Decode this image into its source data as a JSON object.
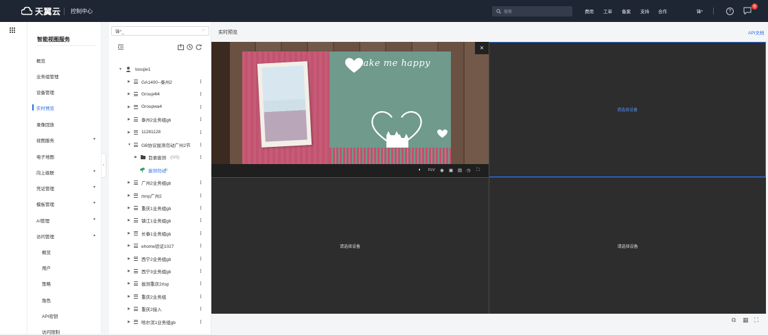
{
  "topbar": {
    "brand": "天翼云",
    "console": "控制中心",
    "search_placeholder": "搜索",
    "nav": [
      "费用",
      "工单",
      "备案",
      "支持",
      "合作"
    ],
    "user": "锋*",
    "help_icon": "?",
    "notification_count": "6"
  },
  "sidebar": {
    "title": "智能视图服务",
    "items": [
      {
        "label": "概览"
      },
      {
        "label": "业务组管理"
      },
      {
        "label": "设备管理"
      },
      {
        "label": "实时预览",
        "active": true
      },
      {
        "label": "录像回放"
      },
      {
        "label": "视图服务",
        "caret": "▾"
      },
      {
        "label": "电子地图"
      },
      {
        "label": "向上级联",
        "caret": "▾"
      },
      {
        "label": "凭证管理",
        "caret": "▾"
      },
      {
        "label": "模板管理",
        "caret": "▾"
      },
      {
        "label": "AI管理",
        "caret": "▾"
      },
      {
        "label": "访问管理",
        "caret": "▴"
      },
      {
        "label": "概览"
      },
      {
        "label": "用户"
      },
      {
        "label": "策略"
      },
      {
        "label": "角色"
      },
      {
        "label": "API密钥"
      },
      {
        "label": "访问限制"
      }
    ]
  },
  "tree": {
    "select_value": "锋*_",
    "root": "toxujie1",
    "nodes": [
      {
        "label": "GA1400--泰州2",
        "type": "group",
        "level": 1
      },
      {
        "label": "Group4l4",
        "type": "group",
        "level": 1
      },
      {
        "label": "Groupwa4",
        "type": "group",
        "level": 1
      },
      {
        "label": "泰州2业务组gb",
        "type": "group",
        "level": 1
      },
      {
        "label": "11281128",
        "type": "group",
        "level": 1
      },
      {
        "label": "GB协议拔测勿动广州2节",
        "type": "group",
        "level": 1,
        "expanded": true
      },
      {
        "label": "目录拔测",
        "suffix": "(0/0)",
        "type": "folder",
        "level": 2
      },
      {
        "label": "拔测勿动",
        "suffix": "ılı",
        "type": "camera",
        "level": 2,
        "playing": true
      },
      {
        "label": "广州2业务组gb",
        "type": "group",
        "level": 1
      },
      {
        "label": "rtmp广州2",
        "type": "group",
        "level": 1
      },
      {
        "label": "重庆1业务组gb",
        "type": "group",
        "level": 1
      },
      {
        "label": "镇江1业务组gb",
        "type": "group",
        "level": 1
      },
      {
        "label": "长春1业务组gb",
        "type": "group",
        "level": 1
      },
      {
        "label": "ehome验证1027",
        "type": "group",
        "level": 1
      },
      {
        "label": "西宁2业务组gb",
        "type": "group",
        "level": 1
      },
      {
        "label": "西宁3业务组gb",
        "type": "group",
        "level": 1
      },
      {
        "label": "拔测重庆2rtsp",
        "type": "group",
        "level": 1
      },
      {
        "label": "重庆2业务组",
        "type": "group",
        "level": 1
      },
      {
        "label": "重庆2接入",
        "type": "group",
        "level": 1
      },
      {
        "label": "哈尔滨1业务组gb",
        "type": "group",
        "level": 1
      }
    ]
  },
  "preview": {
    "title": "实时预览",
    "api_doc": "API文档",
    "video_text": "u make me happy",
    "format": "FLV",
    "empty_msg": "请选择设备"
  },
  "colors": {
    "accent": "#2b6de5",
    "topbar": "#1f2633",
    "grid_bg": "#2d2d2d"
  }
}
